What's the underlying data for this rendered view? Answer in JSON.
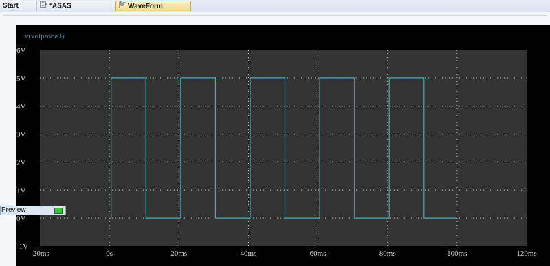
{
  "tabs": [
    {
      "label": "Start"
    },
    {
      "label": "*ASAS"
    },
    {
      "label": "WaveForm"
    }
  ],
  "preview": {
    "label": "Preview"
  },
  "chart_data": {
    "type": "line",
    "title": "v(volprobe3)",
    "series": [
      {
        "name": "v(volprobe3)",
        "x": [
          0,
          0.5,
          0.5,
          10.5,
          10.5,
          20.5,
          20.5,
          30.5,
          30.5,
          40.5,
          40.5,
          50.5,
          50.5,
          60.5,
          60.5,
          70.5,
          70.5,
          80.5,
          80.5,
          90.5,
          90.5,
          100
        ],
        "y": [
          0,
          0,
          5,
          5,
          0,
          0,
          5,
          5,
          0,
          0,
          5,
          5,
          0,
          0,
          5,
          5,
          0,
          0,
          5,
          5,
          0,
          0
        ]
      }
    ],
    "xlim": [
      -20,
      120
    ],
    "ylim": [
      -1,
      6
    ],
    "x_ticks": [
      "-20ms",
      "0s",
      "20ms",
      "40ms",
      "60ms",
      "80ms",
      "100ms",
      "120ms"
    ],
    "y_ticks": [
      "-1V",
      "0V",
      "1V",
      "2V",
      "3V",
      "4V",
      "5V",
      "6V"
    ],
    "grid": true,
    "colors": {
      "background": "#333333",
      "trace": "#4ea8b8",
      "axis_text": "#d8d8d8",
      "title": "#3f8fa8",
      "grid": "#bbbbbb"
    }
  }
}
